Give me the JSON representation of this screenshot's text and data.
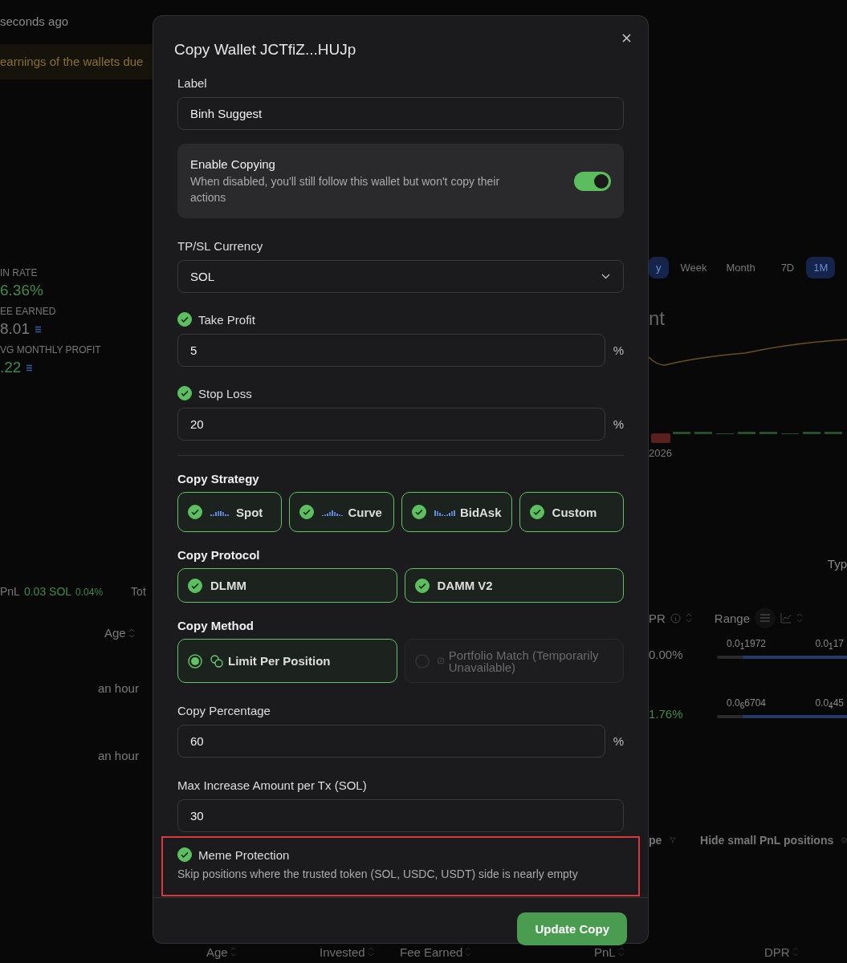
{
  "background": {
    "updated": "seconds ago",
    "banner": "earnings of the wallets due",
    "stats": [
      {
        "label": "IN RATE",
        "value": "6.36%",
        "color": "#3f8a4c",
        "currency": false
      },
      {
        "label": "EE EARNED",
        "value": "8.01",
        "color": "#7a7a7a",
        "currency": true
      },
      {
        "label": "VG MONTHLY PROFIT",
        "value": ".22",
        "color": "#3f8a4c",
        "currency": true
      }
    ],
    "period_tabs": [
      {
        "label": "y",
        "selected": true
      },
      {
        "label": "Week",
        "selected": false
      },
      {
        "label": "Month",
        "selected": false
      }
    ],
    "range_tabs": [
      {
        "label": "7D",
        "selected": false
      },
      {
        "label": "1M",
        "selected": true
      }
    ],
    "chart_title": "nt",
    "chart_date": "2026",
    "summary": {
      "label": "PnL",
      "value": "0.03 SOL",
      "percent": "0.04%",
      "next": "Tot"
    },
    "type_heading": "Typ",
    "columns": {
      "age": "Age",
      "dpr": "PR",
      "range": "Range"
    },
    "rows": [
      {
        "age": "an hour",
        "dpr": "0.00%",
        "color": "#7a7a7a",
        "low": "0.0$_{1}$1972",
        "high": "0.0$_{1}$17"
      },
      {
        "age": "an hour",
        "dpr": "1.76%",
        "color": "#3f8a4c",
        "low": "0.0$_{6}$6704",
        "high": "0.0$_{4}$45"
      }
    ],
    "filter": {
      "type": "pe",
      "hide_small": "Hide small PnL positions"
    },
    "bottom_columns": [
      "Age",
      "Invested",
      "Fee Earned",
      "PnL",
      "DPR"
    ]
  },
  "modal": {
    "title": "Copy Wallet JCTfiZ...HUJp",
    "label_field": {
      "label": "Label",
      "value": "Binh Suggest"
    },
    "enable_copying": {
      "title": "Enable Copying",
      "description": "When disabled, you'll still follow this wallet but won't copy their actions",
      "on": true
    },
    "currency": {
      "label": "TP/SL Currency",
      "value": "SOL"
    },
    "take_profit": {
      "label": "Take Profit",
      "checked": true,
      "value": "5",
      "unit": "%"
    },
    "stop_loss": {
      "label": "Stop Loss",
      "checked": true,
      "value": "20",
      "unit": "%"
    },
    "strategy": {
      "label": "Copy Strategy",
      "options": [
        {
          "label": "Spot",
          "checked": true,
          "kind": "spot"
        },
        {
          "label": "Curve",
          "checked": true,
          "kind": "curve"
        },
        {
          "label": "BidAsk",
          "checked": true,
          "kind": "bidask"
        },
        {
          "label": "Custom",
          "checked": true,
          "kind": "custom"
        }
      ]
    },
    "protocol": {
      "label": "Copy Protocol",
      "options": [
        {
          "label": "DLMM",
          "checked": true
        },
        {
          "label": "DAMM V2",
          "checked": true
        }
      ]
    },
    "method": {
      "label": "Copy Method",
      "options": [
        {
          "label": "Limit Per Position",
          "selected": true,
          "disabled": false,
          "kind": "coins"
        },
        {
          "label": "Portfolio Match (Temporarily Unavailable)",
          "selected": false,
          "disabled": true,
          "kind": "square"
        }
      ]
    },
    "copy_percentage": {
      "label": "Copy Percentage",
      "value": "60",
      "unit": "%"
    },
    "max_increase": {
      "label": "Max Increase Amount per Tx (SOL)",
      "value": "30"
    },
    "meme_protection": {
      "title": "Meme Protection",
      "checked": true,
      "description": "Skip positions where the trusted token (SOL, USDC, USDT) side is nearly empty"
    },
    "submit": "Update Copy"
  }
}
